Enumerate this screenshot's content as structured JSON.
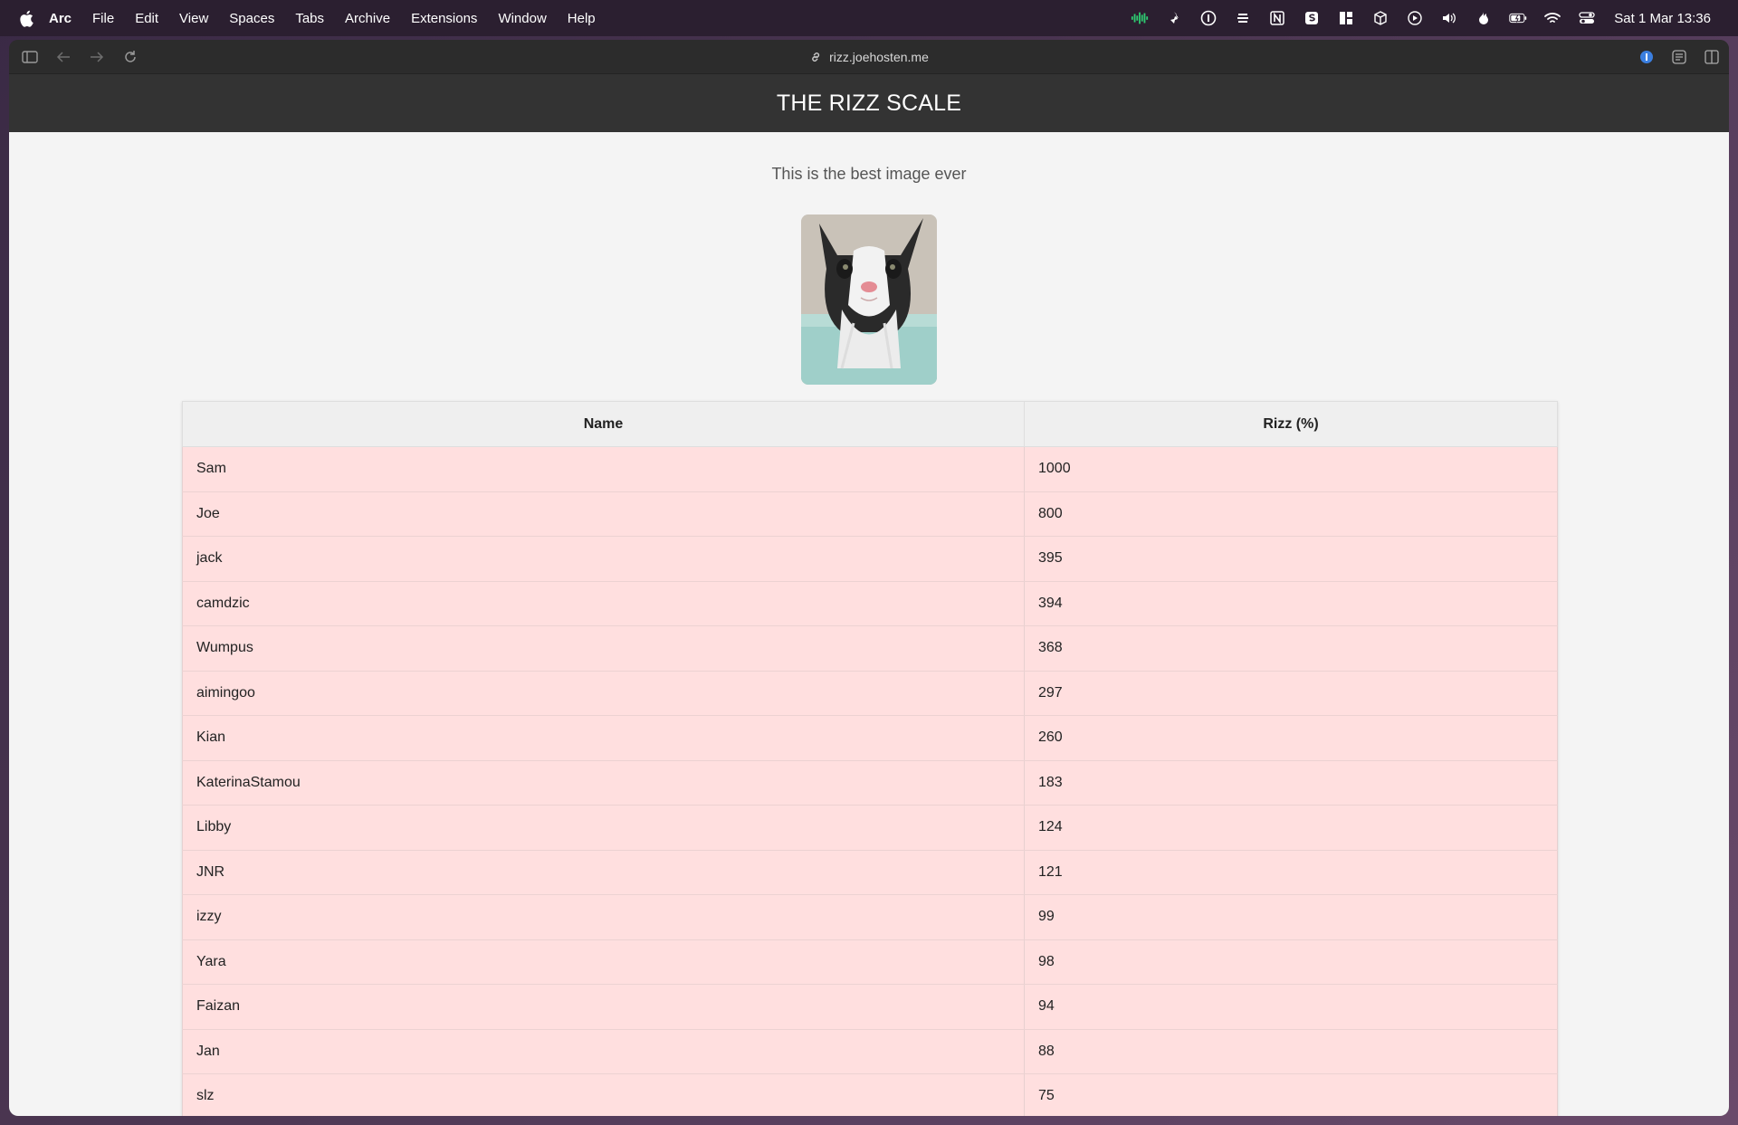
{
  "menubar": {
    "app_name": "Arc",
    "items": [
      "File",
      "Edit",
      "View",
      "Spaces",
      "Tabs",
      "Archive",
      "Extensions",
      "Window",
      "Help"
    ],
    "clock": "Sat 1 Mar  13:36"
  },
  "browser": {
    "url": "rizz.joehosten.me"
  },
  "page": {
    "title": "THE RIZZ SCALE",
    "subtitle": "This is the best image ever",
    "table": {
      "headers": [
        "Name",
        "Rizz (%)"
      ],
      "rows": [
        {
          "name": "Sam",
          "rizz": "1000"
        },
        {
          "name": "Joe",
          "rizz": "800"
        },
        {
          "name": "jack",
          "rizz": "395"
        },
        {
          "name": "camdzic",
          "rizz": "394"
        },
        {
          "name": "Wumpus",
          "rizz": "368"
        },
        {
          "name": "aimingoo",
          "rizz": "297"
        },
        {
          "name": "Kian",
          "rizz": "260"
        },
        {
          "name": "KaterinaStamou",
          "rizz": "183"
        },
        {
          "name": "Libby",
          "rizz": "124"
        },
        {
          "name": "JNR",
          "rizz": "121"
        },
        {
          "name": "izzy",
          "rizz": "99"
        },
        {
          "name": "Yara",
          "rizz": "98"
        },
        {
          "name": "Faizan",
          "rizz": "94"
        },
        {
          "name": "Jan",
          "rizz": "88"
        },
        {
          "name": "slz",
          "rizz": "75"
        }
      ]
    }
  },
  "colors": {
    "header_bg": "#333333",
    "row_bg": "#ffdfdf",
    "page_bg": "#f4f4f4"
  }
}
